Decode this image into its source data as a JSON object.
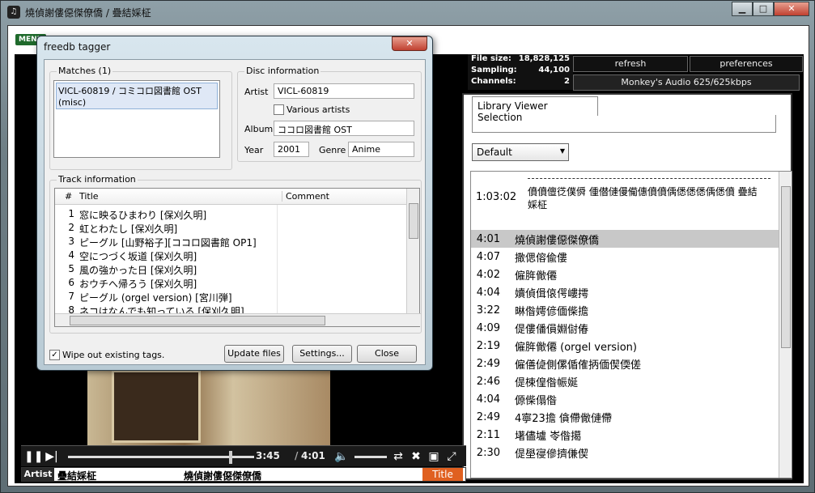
{
  "window": {
    "title": "燒偵謝僂僫傑僚僑 / 疊結婇柾",
    "minimize": "▁",
    "maximize": "□",
    "close": "✕"
  },
  "menu": {
    "label": "MENU"
  },
  "stats": {
    "file_size_label": "File size:",
    "file_size": "18,828,125",
    "sampling_label": "Sampling:",
    "sampling": "44,100",
    "channels_label": "Channels:",
    "channels": "2"
  },
  "toolbar": {
    "refresh": "refresh",
    "preferences": "preferences",
    "codec": "Monkey's Audio 625/625kbps"
  },
  "library": {
    "tab": "Library Viewer Selection",
    "view_select": "Default",
    "album_duration": "1:03:02",
    "album_title": "僨僨儃徔僕僢 偅僣僆僈僃僡僨僨偊僁僁僁偊僁僨 疊結婇柾",
    "tracks": [
      {
        "dur": "4:01",
        "title": "燒偵謝僂僫傑僚僑"
      },
      {
        "dur": "4:07",
        "title": "撒偲傛偸僂"
      },
      {
        "dur": "4:02",
        "title": "僱脌僘僊"
      },
      {
        "dur": "4:04",
        "title": "嬻偵偮偯偔嶁摴"
      },
      {
        "dur": "3:22",
        "title": "晽偺嫮偐偭偨擔"
      },
      {
        "dur": "4:09",
        "title": "偍僂僠傊婣傠偆"
      },
      {
        "dur": "2:19",
        "title": "僱脌僘僊 (orgel version)"
      },
      {
        "dur": "2:49",
        "title": "僱僐偼側傫偱傕抦偭偰偄傞"
      },
      {
        "dur": "2:46",
        "title": "偍梀偟偺帪娫"
      },
      {
        "dur": "4:04",
        "title": "傆偨傝偺"
      },
      {
        "dur": "2:49",
        "title": "4寧23擔 僋僀僘僆僀"
      },
      {
        "dur": "2:11",
        "title": "墸儘壚 岺偺擖"
      },
      {
        "dur": "2:30",
        "title": "偍壆寑傪擠傔偰"
      }
    ]
  },
  "player": {
    "elapsed": "3:45",
    "total": "4:01",
    "progress": 0.93,
    "artist_label": "Artist",
    "artist": "疊結婇柾",
    "track": "燒偵謝僂僫傑僚僑",
    "title_label": "Title"
  },
  "dialog": {
    "title": "freedb tagger",
    "close": "✕",
    "matches_label": "Matches (1)",
    "match": "VICL-60819 / コミコロ図書館 OST (misc)",
    "disc_label": "Disc information",
    "artist_label": "Artist",
    "artist": "VICL-60819",
    "various_label": "Various artists",
    "album_label": "Album",
    "album": "ココロ図書館 OST",
    "year_label": "Year",
    "year": "2001",
    "genre_label": "Genre",
    "genre": "Anime",
    "track_info_label": "Track information",
    "col_num": "#",
    "col_title": "Title",
    "col_comment": "Comment",
    "tracks": [
      {
        "n": "1",
        "t": "窓に映るひまわり [保刈久明]"
      },
      {
        "n": "2",
        "t": "虹とわたし [保刈久明]"
      },
      {
        "n": "3",
        "t": "ピーグル [山野裕子][ココロ図書館 OP1]"
      },
      {
        "n": "4",
        "t": "空につづく坂道 [保刈久明]"
      },
      {
        "n": "5",
        "t": "風の強かった日 [保刈久明]"
      },
      {
        "n": "6",
        "t": "おウチへ帰ろう [保刈久明]"
      },
      {
        "n": "7",
        "t": "ピーグル (orgel version) [宮川弾]"
      },
      {
        "n": "8",
        "t": "ネコはなんでも知っている [保刈久明]"
      }
    ],
    "wipe_label": "Wipe out existing tags.",
    "update_btn": "Update files",
    "settings_btn": "Settings...",
    "close_btn": "Close"
  }
}
